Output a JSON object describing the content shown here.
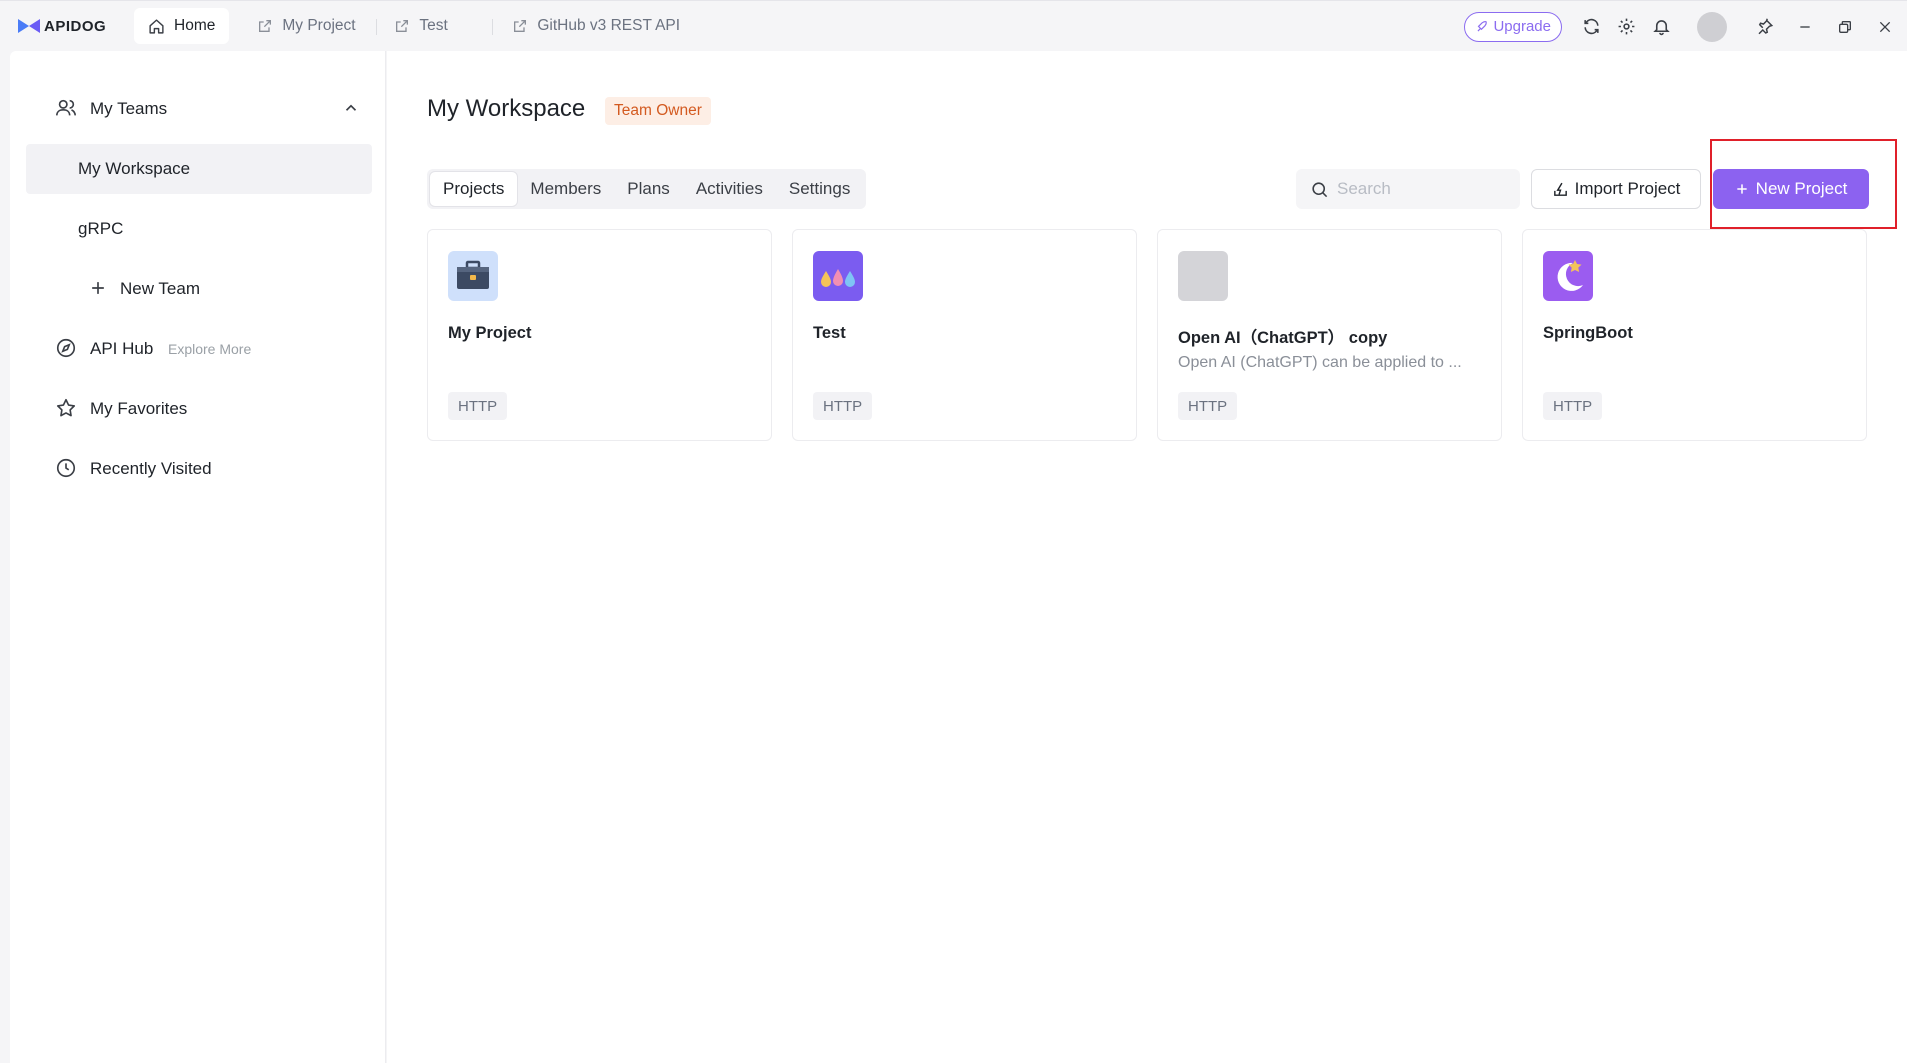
{
  "app": {
    "name": "APIDOG"
  },
  "tabs": [
    {
      "label": "Home",
      "icon": "home-icon",
      "active": true
    },
    {
      "label": "My Project",
      "icon": "external-link-icon",
      "active": false
    },
    {
      "label": "Test",
      "icon": "external-link-icon",
      "active": false
    },
    {
      "label": "GitHub v3 REST API",
      "icon": "external-link-icon",
      "active": false
    }
  ],
  "titlebar": {
    "upgrade_label": "Upgrade"
  },
  "sidebar": {
    "my_teams": "My Teams",
    "items": [
      {
        "label": "My Workspace",
        "selected": true
      },
      {
        "label": "gRPC",
        "selected": false
      }
    ],
    "new_team": "New Team",
    "api_hub": "API Hub",
    "explore_more": "Explore More",
    "my_favorites": "My Favorites",
    "recently_visited": "Recently Visited"
  },
  "workspace": {
    "title": "My Workspace",
    "role_badge": "Team Owner"
  },
  "segments": [
    {
      "label": "Projects",
      "active": true
    },
    {
      "label": "Members",
      "active": false
    },
    {
      "label": "Plans",
      "active": false
    },
    {
      "label": "Activities",
      "active": false
    },
    {
      "label": "Settings",
      "active": false
    }
  ],
  "search": {
    "placeholder": "Search",
    "value": ""
  },
  "actions": {
    "import_label": "Import Project",
    "new_label": "New Project"
  },
  "projects": [
    {
      "name": "My Project",
      "description": "",
      "protocol": "HTTP",
      "icon": "briefcase-icon"
    },
    {
      "name": "Test",
      "description": "",
      "protocol": "HTTP",
      "icon": "drops-icon"
    },
    {
      "name": "Open AI（ChatGPT） copy",
      "description": "Open AI (ChatGPT) can be applied to ...",
      "protocol": "HTTP",
      "icon": "placeholder-icon"
    },
    {
      "name": "SpringBoot",
      "description": "",
      "protocol": "HTTP",
      "icon": "moon-star-icon"
    }
  ],
  "colors": {
    "accent": "#8c62f0",
    "badge_bg": "#fdeee5",
    "badge_text": "#d35a20",
    "highlight": "#e0202a"
  }
}
